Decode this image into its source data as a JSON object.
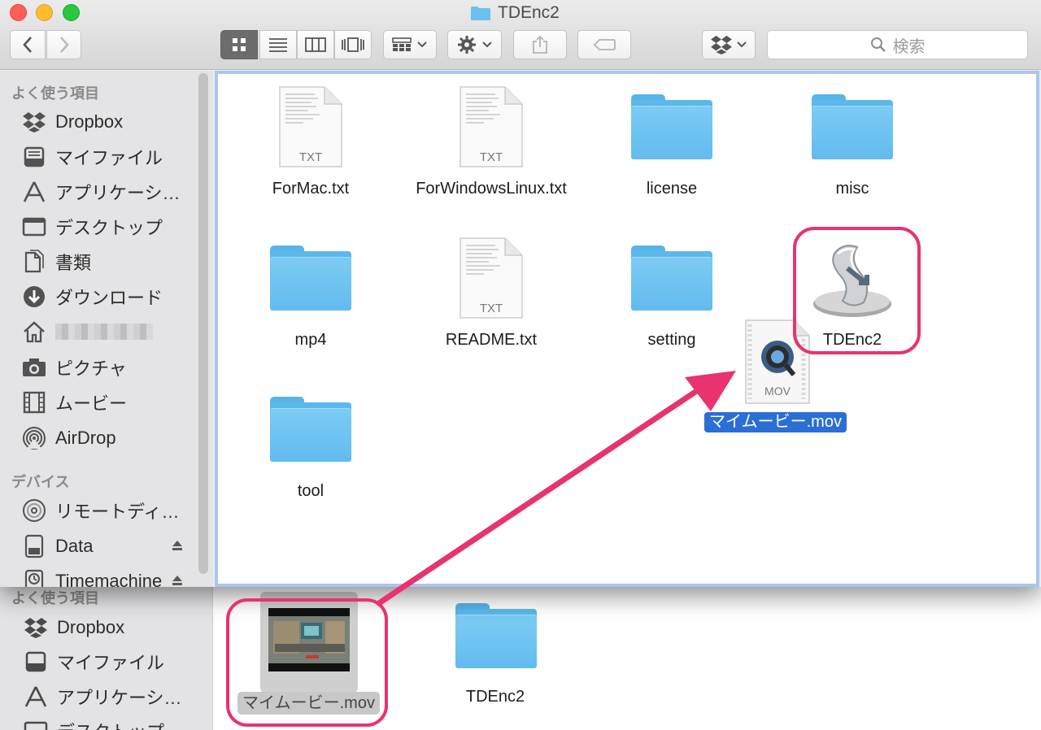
{
  "window": {
    "title": "TDEnc2"
  },
  "toolbar": {
    "back": "back",
    "forward": "forward",
    "views": [
      "icon-view",
      "list-view",
      "column-view",
      "coverflow-view"
    ],
    "search_placeholder": "検索"
  },
  "sidebar": {
    "favorites_header": "よく使う項目",
    "favorites": [
      {
        "label": "Dropbox",
        "icon": "dropbox-icon"
      },
      {
        "label": "マイファイル",
        "icon": "all-files-icon"
      },
      {
        "label": "アプリケーシ…",
        "icon": "applications-icon"
      },
      {
        "label": "デスクトップ",
        "icon": "desktop-icon"
      },
      {
        "label": "書類",
        "icon": "documents-icon"
      },
      {
        "label": "ダウンロード",
        "icon": "downloads-icon"
      },
      {
        "label": "",
        "icon": "home-icon"
      },
      {
        "label": "ピクチャ",
        "icon": "camera-icon"
      },
      {
        "label": "ムービー",
        "icon": "film-icon"
      },
      {
        "label": "AirDrop",
        "icon": "airdrop-icon"
      }
    ],
    "devices_header": "デバイス",
    "devices": [
      {
        "label": "リモートディ…",
        "icon": "disc-icon"
      },
      {
        "label": "Data",
        "icon": "drive-icon"
      },
      {
        "label": "Timemachine",
        "icon": "timemachine-icon"
      }
    ]
  },
  "files": [
    {
      "name": "ForMac.txt",
      "kind": "txt",
      "badge": "TXT"
    },
    {
      "name": "ForWindowsLinux.txt",
      "kind": "txt",
      "badge": "TXT"
    },
    {
      "name": "license",
      "kind": "folder"
    },
    {
      "name": "misc",
      "kind": "folder"
    },
    {
      "name": "mp4",
      "kind": "folder"
    },
    {
      "name": "README.txt",
      "kind": "txt",
      "badge": "TXT"
    },
    {
      "name": "setting",
      "kind": "folder"
    },
    {
      "name": "TDEnc2",
      "kind": "app"
    },
    {
      "name": "tool",
      "kind": "folder"
    }
  ],
  "dragged_file": {
    "name": "マイムービー.mov",
    "badge": "MOV"
  },
  "background_window": {
    "favorites_header": "よく使う項目",
    "sidebar": [
      "Dropbox",
      "マイファイル",
      "アプリケーシ…",
      "デスクトップ"
    ],
    "files": [
      {
        "name": "マイムービー.mov",
        "kind": "movie"
      },
      {
        "name": "TDEnc2",
        "kind": "folder"
      }
    ]
  },
  "colors": {
    "highlight": "#e8336e",
    "folder": "#62bbef",
    "selection": "#2a6ed6"
  }
}
